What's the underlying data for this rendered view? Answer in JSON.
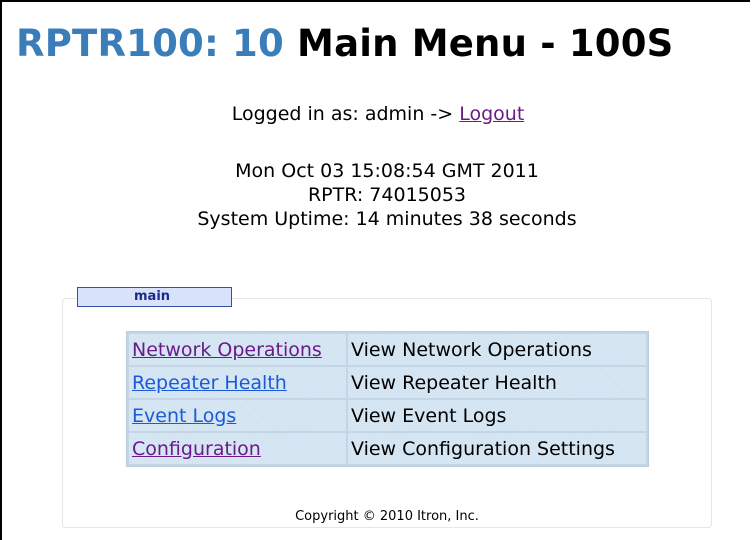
{
  "header": {
    "device": "RPTR100: 10",
    "menu_title": "Main Menu - 100S"
  },
  "session": {
    "logged_in_prefix": "Logged in as: admin ->",
    "logout_label": "Logout"
  },
  "status": {
    "datetime": "Mon Oct 03 15:08:54 GMT 2011",
    "rptr": "RPTR: 74015053",
    "uptime": "System Uptime: 14 minutes 38 seconds"
  },
  "tab": {
    "label": "main"
  },
  "menu": {
    "items": [
      {
        "link": "Network Operations",
        "desc": "View Network Operations",
        "visited": true
      },
      {
        "link": "Repeater Health",
        "desc": "View Repeater Health",
        "visited": false
      },
      {
        "link": "Event Logs",
        "desc": "View Event Logs",
        "visited": false
      },
      {
        "link": "Configuration",
        "desc": "View Configuration Settings",
        "visited": true
      }
    ]
  },
  "footer": {
    "copyright": "Copyright © 2010 Itron, Inc."
  },
  "colors": {
    "device_title": "#3b7db8",
    "visited_link": "#6a1a8a",
    "link": "#1a5ad8",
    "tab_bg": "#d8e2fb",
    "cell_bg": "#dbe9f5"
  }
}
